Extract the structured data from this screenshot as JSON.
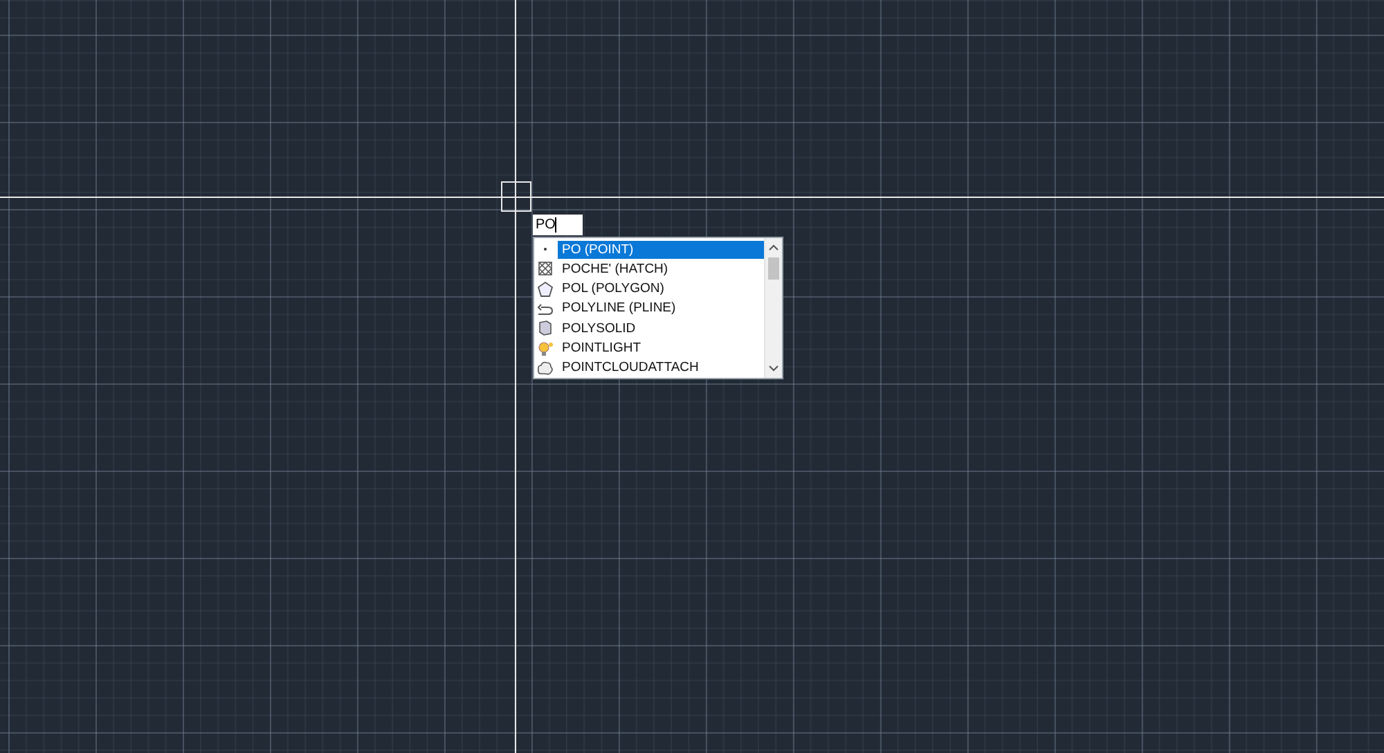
{
  "command_input": {
    "value": "PO"
  },
  "suggestions": [
    {
      "label": "PO (POINT)",
      "kind": "point",
      "selected": true
    },
    {
      "label": "POCHE' (HATCH)",
      "kind": "hatch",
      "selected": false
    },
    {
      "label": "POL (POLYGON)",
      "kind": "polygon",
      "selected": false
    },
    {
      "label": "POLYLINE (PLINE)",
      "kind": "polyline",
      "selected": false
    },
    {
      "label": "POLYSOLID",
      "kind": "polysolid",
      "selected": false
    },
    {
      "label": "POINTLIGHT",
      "kind": "light",
      "selected": false
    },
    {
      "label": "POINTCLOUDATTACH",
      "kind": "cloud",
      "selected": false
    }
  ]
}
